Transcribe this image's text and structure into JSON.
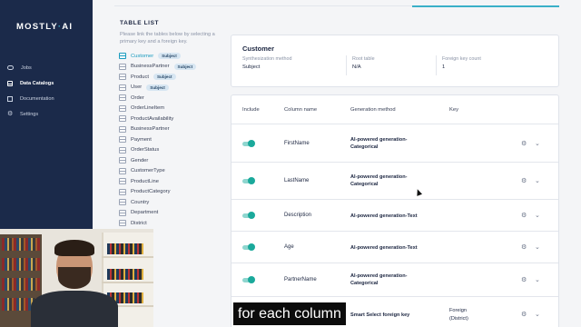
{
  "app": {
    "logo_main": "MOSTLY",
    "logo_dot": "·",
    "logo_end": "AI"
  },
  "nav": [
    {
      "label": "Jobs",
      "icon": "jobs-icon",
      "active": false
    },
    {
      "label": "Data Catalogs",
      "icon": "catalog-icon",
      "active": true
    },
    {
      "label": "Documentation",
      "icon": "documentation-icon",
      "active": false
    },
    {
      "label": "Settings",
      "icon": "gear-icon",
      "active": false
    }
  ],
  "table_list": {
    "title": "TABLE LIST",
    "description": "Please link the tables below by selecting a primary key and a foreign key.",
    "items": [
      {
        "name": "Customer",
        "badge": "Subject",
        "active": true
      },
      {
        "name": "BusinessPartner",
        "badge": "Subject"
      },
      {
        "name": "Product",
        "badge": "Subject"
      },
      {
        "name": "User",
        "badge": "Subject"
      },
      {
        "name": "Order"
      },
      {
        "name": "OrderLineItem"
      },
      {
        "name": "ProductAvailability"
      },
      {
        "name": "BusinessPartner"
      },
      {
        "name": "Payment"
      },
      {
        "name": "OrderStatus"
      },
      {
        "name": "Gender"
      },
      {
        "name": "CustomerType"
      },
      {
        "name": "ProductLine"
      },
      {
        "name": "ProductCategory"
      },
      {
        "name": "Country"
      },
      {
        "name": "Department"
      },
      {
        "name": "District"
      }
    ]
  },
  "info_card": {
    "title": "Customer",
    "synth_label": "Synthesization method",
    "synth_value": "Subject",
    "root_label": "Root table",
    "root_value": "N/A",
    "fk_label": "Foreign key count",
    "fk_value": "1"
  },
  "columns_table": {
    "headers": {
      "include": "Include",
      "column_name": "Column name",
      "generation_method": "Generation method",
      "key": "Key"
    },
    "rows": [
      {
        "name": "FirstName",
        "method": "AI-powered generation-Categorical",
        "key": "",
        "included": true
      },
      {
        "name": "LastName",
        "method": "AI-powered generation-Categorical",
        "key": "",
        "included": true
      },
      {
        "name": "Description",
        "method": "AI-powered generation-Text",
        "key": "",
        "included": true
      },
      {
        "name": "Age",
        "method": "AI-powered generation-Text",
        "key": "",
        "included": true
      },
      {
        "name": "PartnerName",
        "method": "AI-powered generation-Categorical",
        "key": "",
        "included": true
      },
      {
        "name": "",
        "method": "Smart Select foreign key",
        "key": "Foreign (District)",
        "included": true
      }
    ]
  },
  "caption": "for each column"
}
